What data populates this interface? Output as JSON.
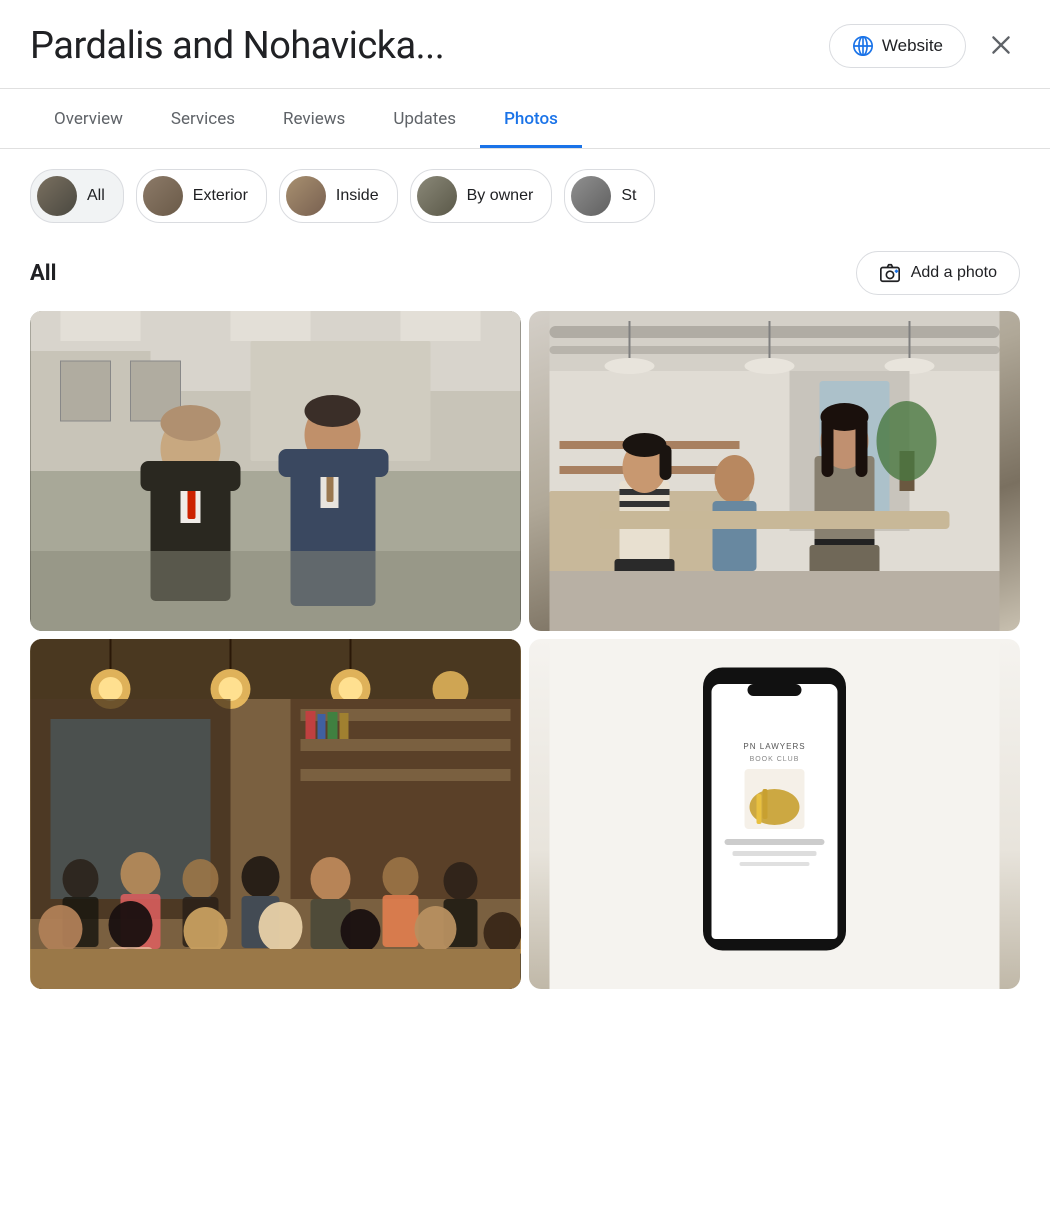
{
  "header": {
    "title": "Pardalis and Nohavicka...",
    "website_btn_label": "Website",
    "close_btn_label": "Close"
  },
  "tabs": [
    {
      "id": "overview",
      "label": "Overview",
      "active": false
    },
    {
      "id": "services",
      "label": "Services",
      "active": false
    },
    {
      "id": "reviews",
      "label": "Reviews",
      "active": false
    },
    {
      "id": "updates",
      "label": "Updates",
      "active": false
    },
    {
      "id": "photos",
      "label": "Photos",
      "active": true
    }
  ],
  "filter_chips": [
    {
      "id": "all",
      "label": "All",
      "active": true
    },
    {
      "id": "exterior",
      "label": "Exterior",
      "active": false
    },
    {
      "id": "inside",
      "label": "Inside",
      "active": false
    },
    {
      "id": "by_owner",
      "label": "By owner",
      "active": false
    },
    {
      "id": "street_view",
      "label": "St",
      "active": false
    }
  ],
  "section": {
    "title": "All",
    "add_photo_label": "Add a photo"
  },
  "photos": [
    {
      "id": "photo1",
      "alt": "Two men in suits in an office"
    },
    {
      "id": "photo2",
      "alt": "People sitting in a modern cafe interior"
    },
    {
      "id": "photo3",
      "alt": "Group of people in a meeting room"
    },
    {
      "id": "photo4",
      "alt": "Phone showing PN Lawyers Book Club"
    }
  ],
  "icons": {
    "globe": "🌐",
    "close": "✕",
    "add_photo": "📷"
  },
  "colors": {
    "active_tab": "#1a73e8",
    "tab_underline": "#1a73e8",
    "border": "#dadce0",
    "text_primary": "#202124",
    "text_secondary": "#5f6368"
  }
}
